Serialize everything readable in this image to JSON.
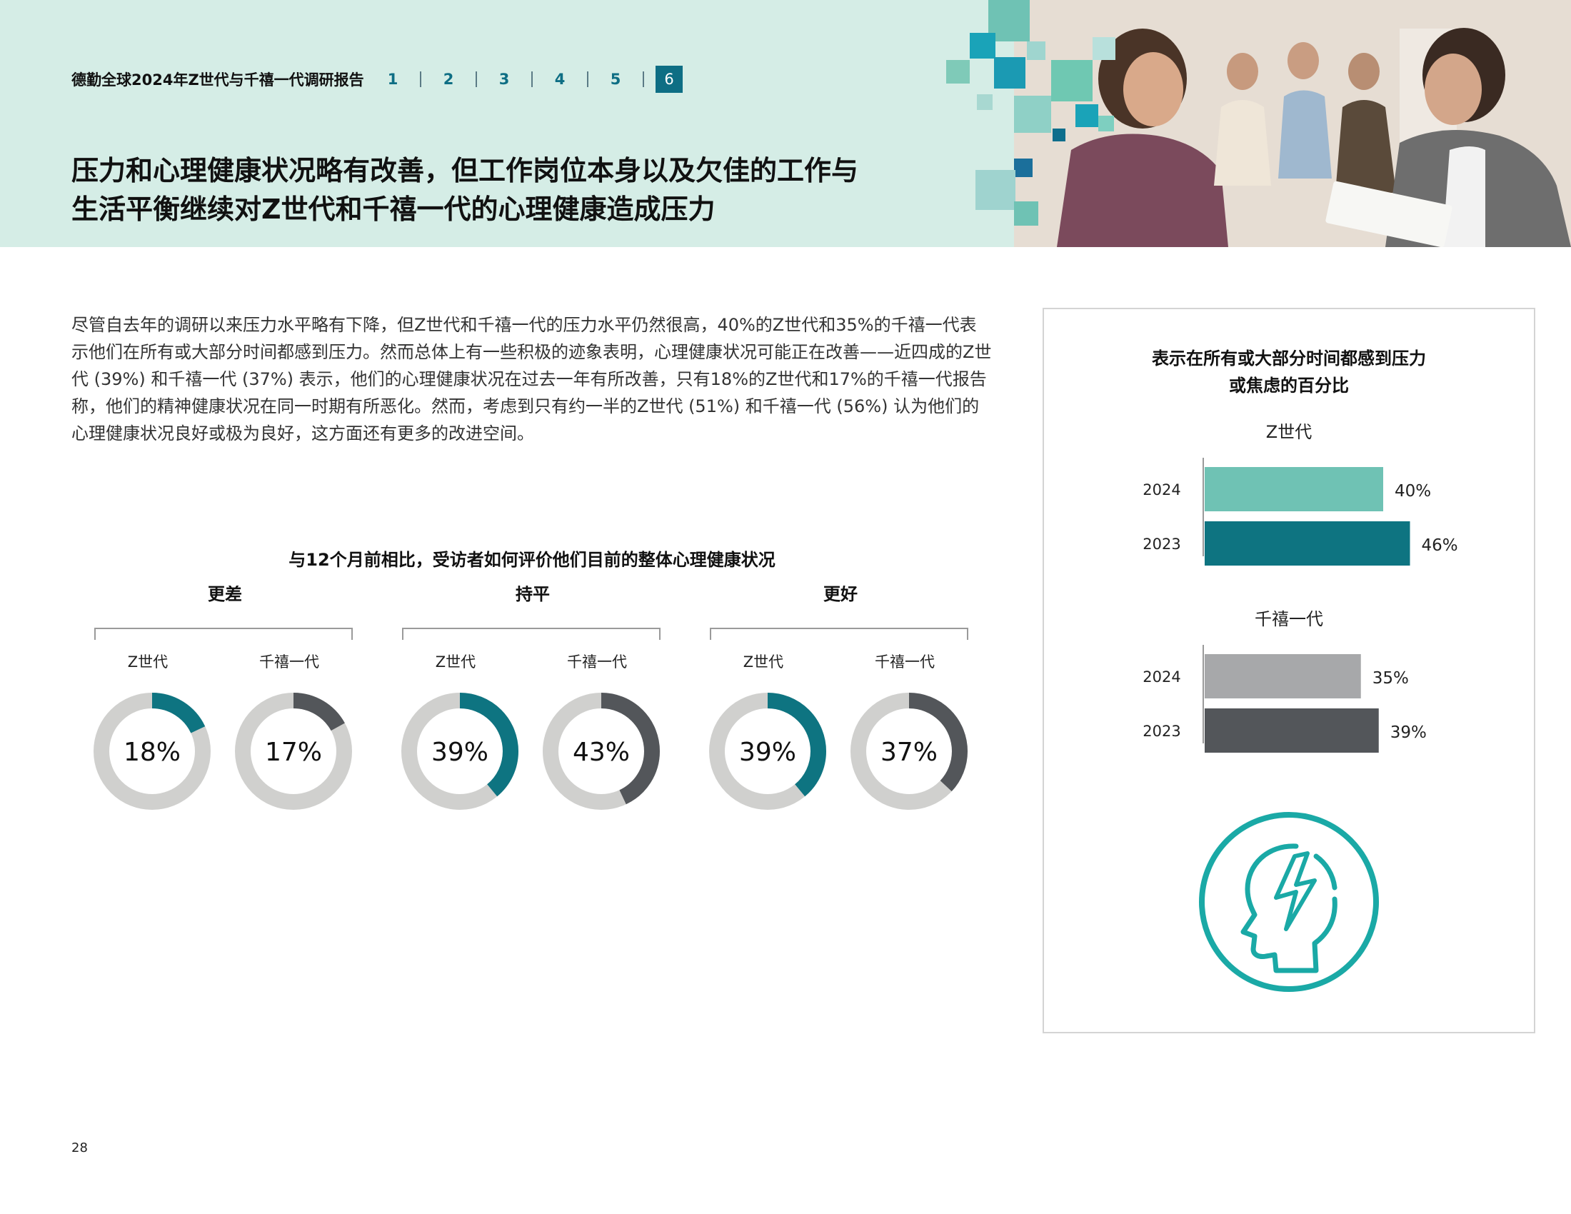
{
  "header": {
    "brand": "德勤全球2024年Z世代与千禧一代调研报告",
    "nav": [
      "1",
      "2",
      "3",
      "4",
      "5",
      "6"
    ],
    "active_nav": "6",
    "headline_line1": "压力和心理健康状况略有改善，但工作岗位本身以及欠佳的工作与",
    "headline_line2": "生活平衡继续对Z世代和千禧一代的心理健康造成压力"
  },
  "body_text": "尽管自去年的调研以来压力水平略有下降，但Z世代和千禧一代的压力水平仍然很高，40%的Z世代和35%的千禧一代表示他们在所有或大部分时间都感到压力。然而总体上有一些积极的迹象表明，心理健康状况可能正在改善——近四成的Z世代 (39%) 和千禧一代 (37%) 表示，他们的心理健康状况在过去一年有所改善，只有18%的Z世代和17%的千禧一代报告称，他们的精神健康状况在同一时期有所恶化。然而，考虑到只有约一半的Z世代 (51%) 和千禧一代 (56%) 认为他们的心理健康状况良好或极为良好，这方面还有更多的改进空间。",
  "page_number": "28",
  "colors": {
    "teal": "#0e7481",
    "dark_gray": "#53565a",
    "ring_bg": "#d0d0ce",
    "light_teal": "#6fc2b4",
    "gray": "#a7a8aa",
    "icon_teal": "#1aa9a6",
    "header_bg": "#d5ede6"
  },
  "chart_data": [
    {
      "type": "donut",
      "title": "与12个月前相比，受访者如何评价他们目前的整体心理健康状况",
      "groups": [
        {
          "label": "更差",
          "items": [
            {
              "name": "Z世代",
              "value": 18,
              "display": "18%",
              "color": "#0e7481"
            },
            {
              "name": "千禧一代",
              "value": 17,
              "display": "17%",
              "color": "#53565a"
            }
          ]
        },
        {
          "label": "持平",
          "items": [
            {
              "name": "Z世代",
              "value": 39,
              "display": "39%",
              "color": "#0e7481"
            },
            {
              "name": "千禧一代",
              "value": 43,
              "display": "43%",
              "color": "#53565a"
            }
          ]
        },
        {
          "label": "更好",
          "items": [
            {
              "name": "Z世代",
              "value": 39,
              "display": "39%",
              "color": "#0e7481"
            },
            {
              "name": "千禧一代",
              "value": 37,
              "display": "37%",
              "color": "#53565a"
            }
          ]
        }
      ]
    },
    {
      "type": "bar",
      "orientation": "horizontal",
      "title_line1": "表示在所有或大部分时间都感到压力",
      "title_line2": "或焦虑的百分比",
      "groups": [
        {
          "label": "Z世代",
          "bars": [
            {
              "category": "2024",
              "value": 40,
              "display": "40%",
              "color": "#6fc2b4"
            },
            {
              "category": "2023",
              "value": 46,
              "display": "46%",
              "color": "#0e7481"
            }
          ]
        },
        {
          "label": "千禧一代",
          "bars": [
            {
              "category": "2024",
              "value": 35,
              "display": "35%",
              "color": "#a7a8aa"
            },
            {
              "category": "2023",
              "value": 39,
              "display": "39%",
              "color": "#53565a"
            }
          ]
        }
      ]
    }
  ],
  "icons": [
    "head-lightning-icon"
  ]
}
